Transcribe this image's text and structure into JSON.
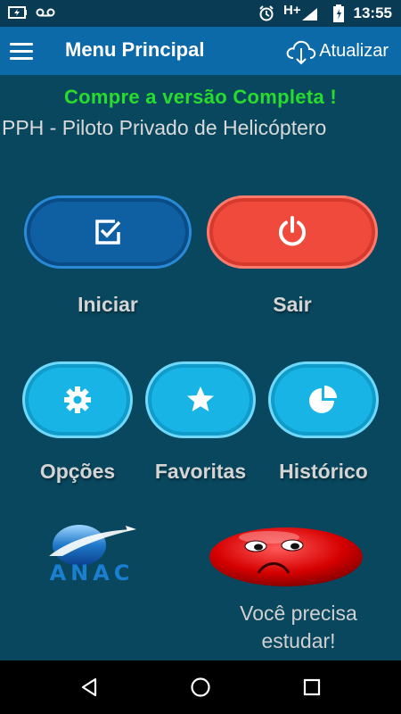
{
  "status_bar": {
    "time": "13:55",
    "network": "H+",
    "icons": [
      "battery-saver-icon",
      "voicemail-icon",
      "alarm-icon",
      "signal-icon",
      "battery-icon"
    ]
  },
  "app_bar": {
    "title": "Menu Principal",
    "update_label": "Atualizar",
    "color": "#0c6aa8"
  },
  "promo_text": "Compre a versão Completa !",
  "subtitle": "PPH - Piloto Privado de Helicóptero",
  "main_buttons": {
    "start_label": "Iniciar",
    "exit_label": "Sair"
  },
  "secondary_buttons": {
    "options_label": "Opções",
    "favorites_label": "Favoritas",
    "history_label": "Histórico"
  },
  "anac_logo_text": "ANAC",
  "status_message": "Você precisa estudar!",
  "colors": {
    "background": "#08475e",
    "promo": "#27dc2b",
    "start_button": "#0f5fa3",
    "exit_button": "#f04a3d",
    "secondary_button": "#19b4e6"
  }
}
